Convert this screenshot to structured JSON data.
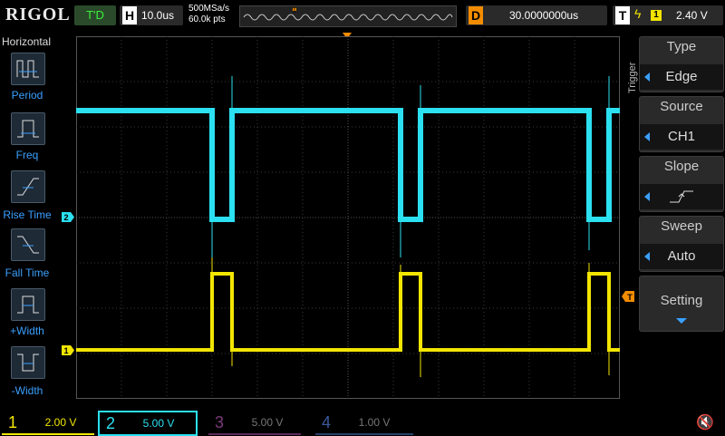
{
  "brand": "RIGOL",
  "run_state": "T'D",
  "horizontal": {
    "letter": "H",
    "timebase": "10.0us",
    "sample_rate": "500MSa/s",
    "mem_depth": "60.0k pts"
  },
  "delay": {
    "letter": "D",
    "value": "30.0000000us"
  },
  "trigger_status": {
    "letter": "T",
    "channel": "1",
    "level": "2.40 V",
    "edge_icon": "rising-edge-icon"
  },
  "left_panel": {
    "title": "Horizontal",
    "items": [
      "Period",
      "Freq",
      "Rise Time",
      "Fall Time",
      "+Width",
      "-Width"
    ]
  },
  "right_panel": {
    "title": "Trigger",
    "type": {
      "head": "Type",
      "value": "Edge"
    },
    "source": {
      "head": "Source",
      "value": "CH1"
    },
    "slope": {
      "head": "Slope",
      "icon": "rising-slope-icon"
    },
    "sweep": {
      "head": "Sweep",
      "value": "Auto"
    },
    "setting": {
      "head": "Setting"
    }
  },
  "markers": {
    "trigger_pos": "T",
    "ch1": "1",
    "ch2": "2",
    "trig_level": "T"
  },
  "channels": [
    {
      "num": "1",
      "scale": "2.00 V",
      "color": "#f2e600",
      "active": true
    },
    {
      "num": "2",
      "scale": "5.00 V",
      "color": "#00e5ff",
      "active": true
    },
    {
      "num": "3",
      "scale": "5.00 V",
      "color": "#d040d0",
      "active": false
    },
    {
      "num": "4",
      "scale": "1.00 V",
      "color": "#3a7cff",
      "active": false
    }
  ],
  "colors": {
    "ch1": "#f2e600",
    "ch2": "#2be0f0",
    "trigger": "#f28c00",
    "accent": "#3aa0ff"
  }
}
